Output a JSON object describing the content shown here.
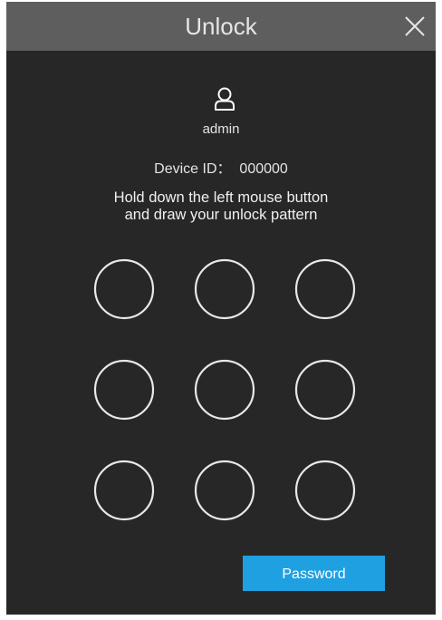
{
  "dialog": {
    "title": "Unlock",
    "close_icon": "close-icon"
  },
  "user": {
    "icon": "user-icon",
    "name": "admin"
  },
  "device": {
    "label": "Device ID：",
    "value": "000000"
  },
  "instruction": {
    "line1": "Hold down the left mouse button",
    "line2": "and draw your unlock pattern"
  },
  "pattern": {
    "rows": 3,
    "cols": 3
  },
  "buttons": {
    "password_label": "Password"
  },
  "colors": {
    "title_bar": "#5e5e5e",
    "background": "#272727",
    "accent": "#1fa0e1"
  }
}
